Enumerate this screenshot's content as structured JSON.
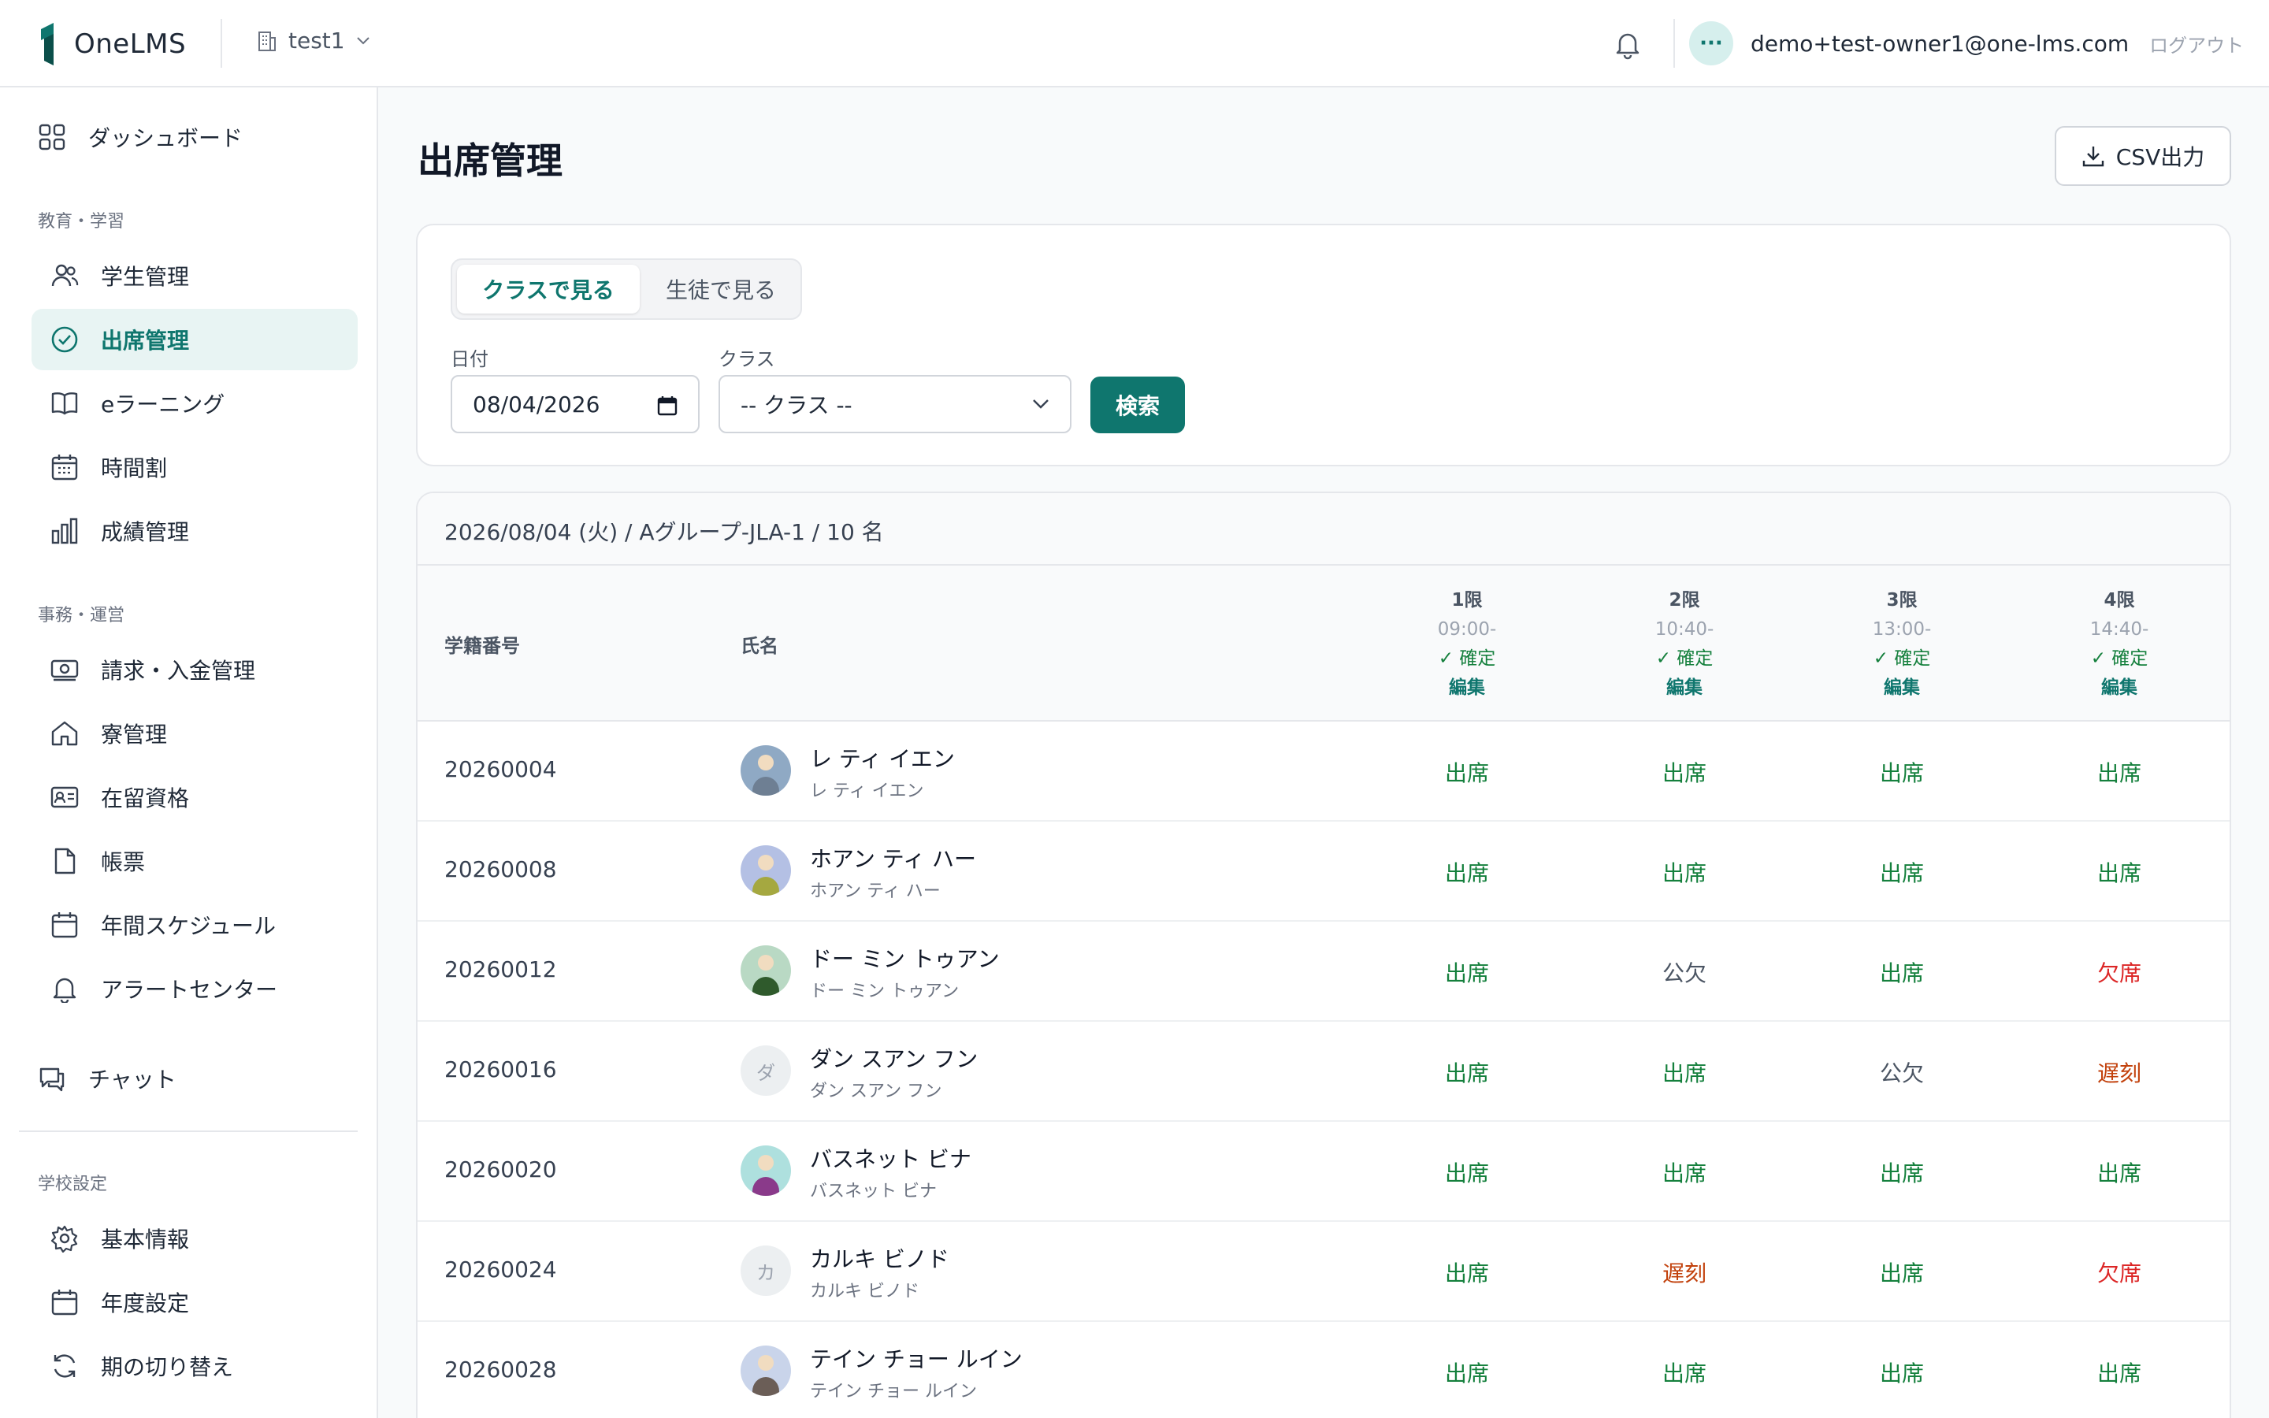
{
  "header": {
    "app_name": "OneLMS",
    "tenant": "test1",
    "user_initial": "···",
    "email": "demo+test-owner1@one-lms.com",
    "logout": "ログアウト"
  },
  "sidebar": {
    "dashboard": "ダッシュボード",
    "section_education": "教育・学習",
    "students": "学生管理",
    "attendance": "出席管理",
    "elearning": "eラーニング",
    "timetable": "時間割",
    "grades": "成績管理",
    "section_office": "事務・運営",
    "billing": "請求・入金管理",
    "dorm": "寮管理",
    "residence": "在留資格",
    "forms": "帳票",
    "schedule": "年間スケジュール",
    "alerts": "アラートセンター",
    "chat": "チャット",
    "section_school": "学校設定",
    "basic_info": "基本情報",
    "year_settings": "年度設定",
    "term_switch": "期の切り替え"
  },
  "main": {
    "title": "出席管理",
    "csv_button": "CSV出力",
    "tabs": [
      "クラスで見る",
      "生徒で見る"
    ],
    "date_label": "日付",
    "date_value": "08/04/2026",
    "class_label": "クラス",
    "class_value": "-- クラス --",
    "search_button": "検索"
  },
  "table": {
    "summary": "2026/08/04 (火) / Aグループ-JLA-1 / 10 名",
    "col_id": "学籍番号",
    "col_name": "氏名",
    "periods": [
      {
        "name": "1限",
        "time": "09:00-",
        "confirmed": "✓ 確定",
        "edit": "編集"
      },
      {
        "name": "2限",
        "time": "10:40-",
        "confirmed": "✓ 確定",
        "edit": "編集"
      },
      {
        "name": "3限",
        "time": "13:00-",
        "confirmed": "✓ 確定",
        "edit": "編集"
      },
      {
        "name": "4限",
        "time": "14:40-",
        "confirmed": "✓ 確定",
        "edit": "編集"
      }
    ],
    "rows": [
      {
        "id": "20260004",
        "name": "レ ティ イエン",
        "kana": "レ ティ イエン",
        "avatar": "",
        "status": [
          "出席",
          "出席",
          "出席",
          "出席"
        ]
      },
      {
        "id": "20260008",
        "name": "ホアン ティ ハー",
        "kana": "ホアン ティ ハー",
        "avatar": "",
        "status": [
          "出席",
          "出席",
          "出席",
          "出席"
        ]
      },
      {
        "id": "20260012",
        "name": "ドー ミン トゥアン",
        "kana": "ドー ミン トゥアン",
        "avatar": "",
        "status": [
          "出席",
          "公欠",
          "出席",
          "欠席"
        ]
      },
      {
        "id": "20260016",
        "name": "ダン スアン フン",
        "kana": "ダン スアン フン",
        "avatar": "ダ",
        "status": [
          "出席",
          "出席",
          "公欠",
          "遅刻"
        ]
      },
      {
        "id": "20260020",
        "name": "バスネット ビナ",
        "kana": "バスネット ビナ",
        "avatar": "",
        "status": [
          "出席",
          "出席",
          "出席",
          "出席"
        ]
      },
      {
        "id": "20260024",
        "name": "カルキ ビノド",
        "kana": "カルキ ビノド",
        "avatar": "カ",
        "status": [
          "出席",
          "遅刻",
          "出席",
          "欠席"
        ]
      },
      {
        "id": "20260028",
        "name": "テイン チョー ルイン",
        "kana": "テイン チョー ルイン",
        "avatar": "",
        "status": [
          "出席",
          "出席",
          "出席",
          "出席"
        ]
      }
    ]
  },
  "colors": {
    "accent": "#0f766e",
    "present": "#15803d",
    "absent": "#dc2626",
    "late": "#c2410c",
    "excused": "#4b5563"
  }
}
